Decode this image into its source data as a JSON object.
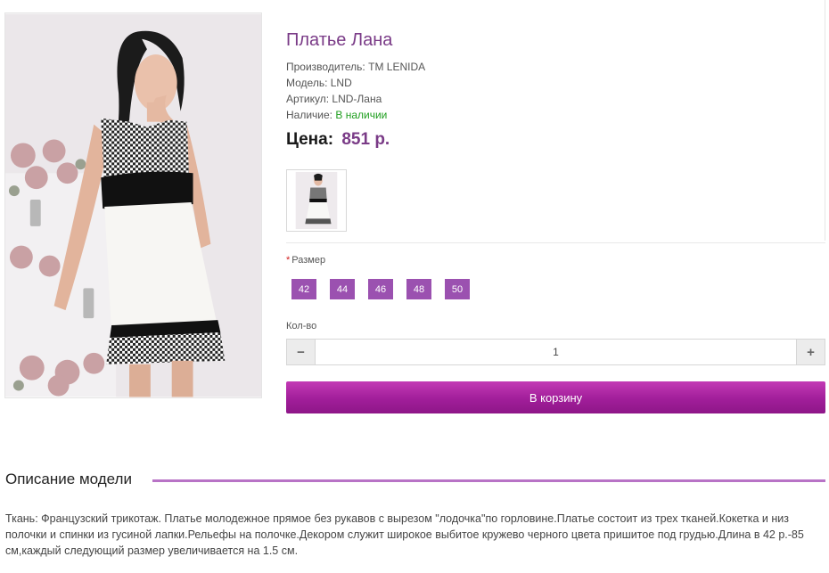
{
  "product": {
    "title": "Платье Лана",
    "manufacturer_label": "Производитель:",
    "manufacturer": "TM LENIDA",
    "model_label": "Модель:",
    "model": "LND",
    "sku_label": "Артикул:",
    "sku": "LND-Лана",
    "availability_label": "Наличие:",
    "availability": "В наличии",
    "price_label": "Цена:",
    "price": "851 р."
  },
  "options": {
    "required_mark": "*",
    "size_label": "Размер",
    "sizes": [
      "42",
      "44",
      "46",
      "48",
      "50"
    ],
    "qty_label": "Кол-во",
    "qty_value": "1",
    "minus": "−",
    "plus": "+"
  },
  "cart": {
    "button_label": "В корзину"
  },
  "description": {
    "heading": "Описание модели",
    "text": "Ткань: Французский трикотаж. Платье молодежное прямое без рукавов с вырезом \"лодочка\"по горловине.Платье состоит из трех тканей.Кокетка и низ полочки и спинки из гусиной лапки.Рельефы на полочке.Декором служит широкое выбитое кружево черного цвета пришитое под грудью.Длина в 42 р.-85 см,каждый следующий размер увеличивается на 1.5 см."
  },
  "colors": {
    "accent": "#7a3b87",
    "size_button": "#9b51b0",
    "cart_button": "#a11e9a",
    "in_stock": "#1e9e1e"
  }
}
